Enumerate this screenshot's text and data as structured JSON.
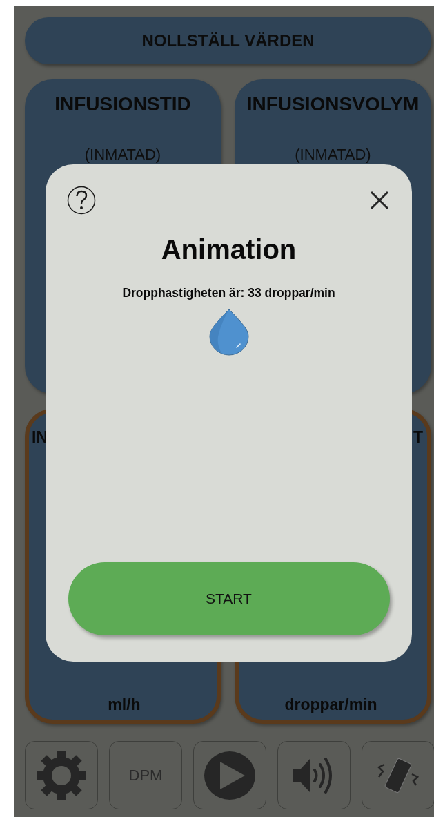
{
  "reset_button": "NOLLSTÄLL VÄRDEN",
  "cards": [
    {
      "title": "INFUSIONSTID",
      "subtitle": "(INMATAD)",
      "highlighted": false
    },
    {
      "title": "INFUSIONSVOLYM",
      "subtitle": "(INMATAD)",
      "highlighted": false
    },
    {
      "title": "IN",
      "unit": "ml/h",
      "highlighted": true
    },
    {
      "title": "T",
      "unit": "droppar/min",
      "highlighted": true
    }
  ],
  "toolbar": [
    {
      "kind": "settings"
    },
    {
      "kind": "text",
      "label": "DPM"
    },
    {
      "kind": "play"
    },
    {
      "kind": "sound"
    },
    {
      "kind": "vibrate"
    }
  ],
  "dialog": {
    "title": "Animation",
    "message": "Dropphastigheten är: 33 droppar/min",
    "start_button": "START"
  }
}
